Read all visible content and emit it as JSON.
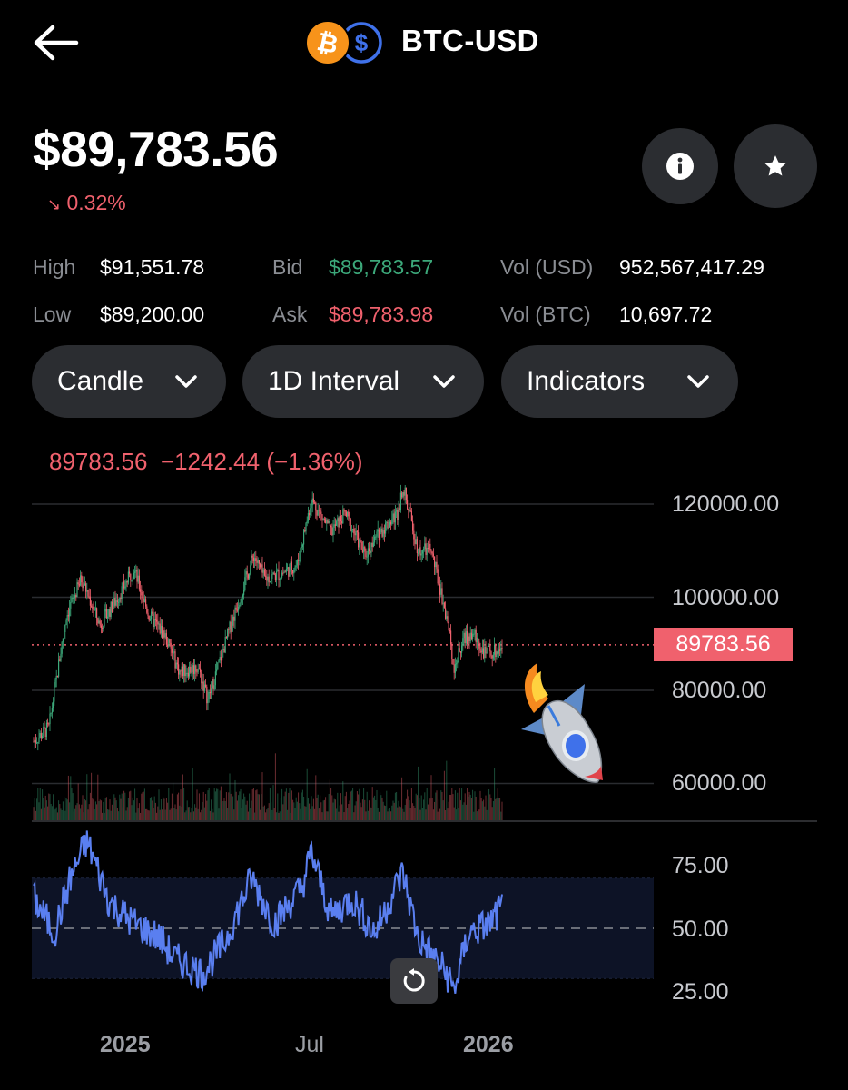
{
  "header": {
    "back_icon": "arrow-left-icon",
    "pair_icons": [
      "bitcoin-coin-icon",
      "dollar-coin-icon"
    ],
    "title": "BTC-USD"
  },
  "quote": {
    "price": "$89,783.56",
    "change_arrow": "↘",
    "change_pct": "0.32%",
    "info_icon": "info-icon",
    "star_icon": "star-icon"
  },
  "stats": {
    "high_label": "High",
    "high_value": "$91,551.78",
    "low_label": "Low",
    "low_value": "$89,200.00",
    "bid_label": "Bid",
    "bid_value": "$89,783.57",
    "ask_label": "Ask",
    "ask_value": "$89,783.98",
    "vol_usd_label": "Vol (USD)",
    "vol_usd_value": "952,567,417.29",
    "vol_btc_label": "Vol (BTC)",
    "vol_btc_value": "10,697.72"
  },
  "controls": {
    "chart_type": "Candle",
    "interval": "1D Interval",
    "indicators": "Indicators"
  },
  "chart_header": {
    "last": "89783.56",
    "change": "−1242.44",
    "change_pct": "(−1.36%)"
  },
  "colors": {
    "up": "#3ca87a",
    "down": "#f0616d",
    "rsi_line": "#5a7ff0",
    "rsi_band": "#0d1326",
    "background": "#000000",
    "button": "#2b2d31"
  },
  "chart_data": {
    "type": "candlestick",
    "price_axis": {
      "ticks": [
        "120000.00",
        "100000.00",
        "80000.00",
        "60000.00"
      ],
      "tick_values": [
        120000,
        100000,
        80000,
        60000
      ],
      "ylim": [
        55000,
        125000
      ]
    },
    "current_price_label": "89783.56",
    "current_price": 89783.56,
    "x_ticks": [
      "2025",
      "Jul",
      "2026"
    ],
    "close_series": {
      "x": [
        "2024-11-01",
        "2024-11-15",
        "2024-12-01",
        "2024-12-15",
        "2025-01-01",
        "2025-01-15",
        "2025-02-01",
        "2025-02-15",
        "2025-03-01",
        "2025-03-15",
        "2025-04-01",
        "2025-04-10",
        "2025-05-01",
        "2025-05-22",
        "2025-06-01",
        "2025-06-15",
        "2025-07-01",
        "2025-07-14",
        "2025-08-01",
        "2025-08-14",
        "2025-09-01",
        "2025-09-15",
        "2025-10-01",
        "2025-10-06",
        "2025-10-20",
        "2025-11-01",
        "2025-11-15",
        "2025-11-22",
        "2025-12-01",
        "2025-12-10",
        "2025-12-20",
        "2026-01-01",
        "2026-01-05"
      ],
      "y": [
        69000,
        72000,
        96000,
        104000,
        94000,
        99000,
        106000,
        96000,
        92000,
        84000,
        85000,
        78000,
        94000,
        109000,
        104000,
        105000,
        107000,
        121000,
        114000,
        118000,
        109000,
        114000,
        118000,
        124000,
        110000,
        110000,
        96000,
        85000,
        91000,
        92000,
        88000,
        88500,
        89783.56
      ]
    },
    "rsi": {
      "axis_ticks": [
        "75.00",
        "50.00",
        "25.00"
      ],
      "tick_values": [
        75,
        50,
        25
      ],
      "ylim": [
        20,
        90
      ],
      "band": [
        30,
        70
      ],
      "midline": 50,
      "x": [
        "2024-11-01",
        "2024-11-20",
        "2024-12-05",
        "2024-12-20",
        "2025-01-10",
        "2025-02-01",
        "2025-02-25",
        "2025-03-10",
        "2025-04-05",
        "2025-04-25",
        "2025-05-20",
        "2025-06-10",
        "2025-07-05",
        "2025-07-14",
        "2025-08-01",
        "2025-08-20",
        "2025-09-10",
        "2025-10-01",
        "2025-10-06",
        "2025-10-20",
        "2025-11-15",
        "2025-11-22",
        "2025-12-05",
        "2025-12-25",
        "2026-01-05"
      ],
      "y": [
        62,
        48,
        70,
        85,
        60,
        52,
        46,
        38,
        32,
        44,
        70,
        52,
        66,
        80,
        55,
        62,
        48,
        68,
        72,
        46,
        32,
        25,
        48,
        52,
        58
      ]
    }
  }
}
